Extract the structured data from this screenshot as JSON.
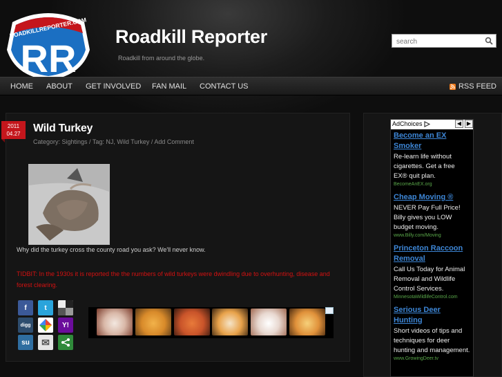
{
  "header": {
    "logo_text": "ROADKILLREPORTER.COM",
    "logo_letters": "RR",
    "title": "Roadkill Reporter",
    "tagline": "Roadkill from around the globe.",
    "search_placeholder": "search"
  },
  "nav": {
    "items": [
      "HOME",
      "ABOUT",
      "GET INVOLVED",
      "FAN MAIL",
      "CONTACT US"
    ],
    "rss": "RSS FEED"
  },
  "post": {
    "date_year": "2011",
    "date_day": "04.27",
    "title": "Wild Turkey",
    "meta": "Category: Sightings / Tag: NJ, Wild Turkey / Add Comment",
    "body": "Why did the turkey cross the county road you ask?  We'll never know.",
    "tidbit": "TIDBIT:  In the 1930s it is reported the the numbers of wild turkeys were dwindling due to overhunting, disease and forest clearing.",
    "share_icons": [
      "facebook-icon",
      "twitter-icon",
      "delicious-icon",
      "digg-icon",
      "google-icon",
      "yahoo-icon",
      "stumbleupon-icon",
      "email-icon",
      "share-icon"
    ],
    "share_labels": [
      "f",
      "t",
      "",
      "digg",
      "",
      "Y!",
      "su",
      "✉",
      "<"
    ]
  },
  "ads": {
    "choices_label": "AdChoices",
    "items": [
      {
        "headline": "Become an EX Smoker",
        "body": "Re-learn life without cigarettes. Get a free EX® quit plan.",
        "url": "BecomeAnEX.org"
      },
      {
        "headline": "Cheap Moving ®",
        "body": "NEVER Pay Full Price! Billy gives you LOW budget moving.",
        "url": "www.Billy.com/Moving"
      },
      {
        "headline": "Princeton Raccoon Removal",
        "body": "Call Us Today for Animal Removal and Wildlife Control Services.",
        "url": "MinnesotaWildlifeControl.com"
      },
      {
        "headline": "Serious Deer Hunting",
        "body": "Short videos of tips and techniques for deer hunting and management.",
        "url": "www.GrowingDeer.tv"
      }
    ]
  },
  "colors": {
    "accent_red": "#c4161c",
    "ad_link": "#3d86d6",
    "ad_url": "#5aa84a",
    "logo_blue": "#1b6fc2"
  }
}
